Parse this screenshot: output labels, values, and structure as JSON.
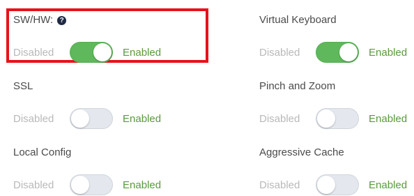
{
  "settings": [
    {
      "id": "sw-hw",
      "title": "SW/HW:",
      "help_icon": "?",
      "off_label": "Disabled",
      "on_label": "Enabled",
      "enabled": true,
      "highlighted": true
    },
    {
      "id": "virtual-keyboard",
      "title": "Virtual Keyboard",
      "off_label": "Disabled",
      "on_label": "Enabled",
      "enabled": true
    },
    {
      "id": "ssl",
      "title": "SSL",
      "off_label": "Disabled",
      "on_label": "Enabled",
      "enabled": false
    },
    {
      "id": "pinch-and-zoom",
      "title": "Pinch and Zoom",
      "off_label": "Disabled",
      "on_label": "Enabled",
      "enabled": false
    },
    {
      "id": "local-config",
      "title": "Local Config",
      "off_label": "Disabled",
      "on_label": "Enabled",
      "enabled": false
    },
    {
      "id": "aggressive-cache",
      "title": "Aggressive Cache",
      "off_label": "Disabled",
      "on_label": "Enabled",
      "enabled": false
    }
  ],
  "colors": {
    "highlight": "#e8121a",
    "toggle_on": "#5fb85b",
    "toggle_off": "#e4e8ee",
    "enabled_text": "#5a9a3c",
    "disabled_text": "#b9b9b9"
  }
}
